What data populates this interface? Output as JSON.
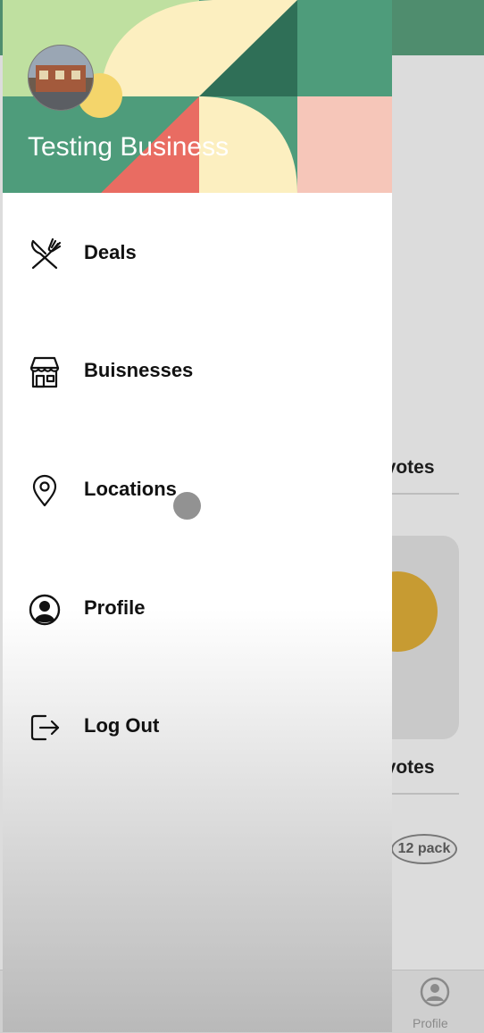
{
  "colors": {
    "header_green": "#4e9c7b",
    "dark_green": "#2f6f57",
    "light_green": "#bfe0a0",
    "cream": "#fcefc0",
    "salmon": "#e96c62",
    "pink": "#f6c6b9",
    "yellow": "#f4d56b",
    "menu_text": "#111111"
  },
  "drawer": {
    "business_name": "Testing Business",
    "menu": [
      {
        "label": "Deals",
        "icon": "fork-knife-icon"
      },
      {
        "label": "Buisnesses",
        "icon": "storefront-icon"
      },
      {
        "label": "Locations",
        "icon": "map-pin-icon"
      },
      {
        "label": "Profile",
        "icon": "user-circle-icon"
      },
      {
        "label": "Log Out",
        "icon": "logout-icon"
      }
    ]
  },
  "background": {
    "votes_label_1": "l votes",
    "votes_label_2": "l votes",
    "pack_text": "12 pack",
    "tab_profile_label": "Profile"
  }
}
